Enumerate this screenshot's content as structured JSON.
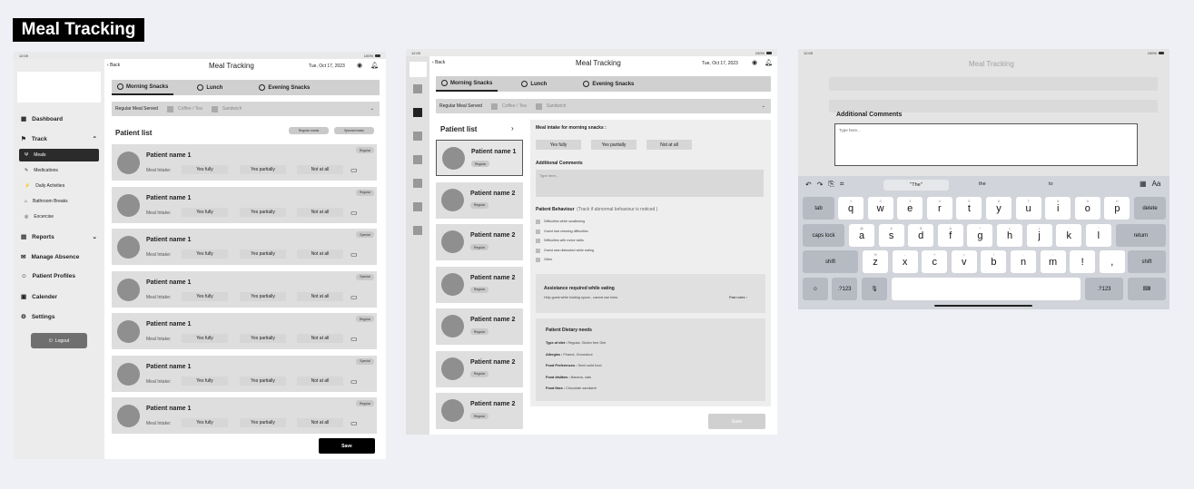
{
  "badge": "Meal Tracking",
  "status": {
    "time": "12:09",
    "date": "Tue, Oct 17",
    "battery": "100%"
  },
  "header": {
    "back": "Back",
    "title": "Meal Tracking",
    "date": "Tue, Oct 17, 2023"
  },
  "tabs": [
    "Morning Snacks",
    "Lunch",
    "Evening Snacks"
  ],
  "served": {
    "label": "Regular Meal Served",
    "opt1": "Coffee / Tea",
    "opt2": "Sandwich"
  },
  "sidebar": {
    "dashboard": "Dashboard",
    "track": "Track",
    "sub": [
      "Meals",
      "Medications",
      "Daily Activities",
      "Bathroom Breaks",
      "Excercise"
    ],
    "reports": "Reports",
    "absence": "Manage Absence",
    "profiles": "Patient Profiles",
    "calendar": "Calender",
    "settings": "Settings",
    "logout": "Logout"
  },
  "list": {
    "title": "Patient list",
    "legend1": "Regular meals",
    "legend2": "Special meals",
    "intake": "Meal Intake:",
    "yes_fully": "Yes fully",
    "yes_partially": "Yes partially",
    "not_at_all": "Not at all",
    "save": "Save",
    "patients": [
      {
        "name": "Patient name 1",
        "tag": "Regular"
      },
      {
        "name": "Patient name 1",
        "tag": "Regular"
      },
      {
        "name": "Patient name 1",
        "tag": "Special"
      },
      {
        "name": "Patient name 1",
        "tag": "Special"
      },
      {
        "name": "Patient name 1",
        "tag": "Regular"
      },
      {
        "name": "Patient name 1",
        "tag": "Special"
      },
      {
        "name": "Patient name 1",
        "tag": "Regular"
      }
    ]
  },
  "detail": {
    "list_title": "Patient list",
    "patients": [
      {
        "name": "Patient name 1",
        "tag": "Regular"
      },
      {
        "name": "Patient name 2",
        "tag": "Regular"
      },
      {
        "name": "Patient name 2",
        "tag": "Regular"
      },
      {
        "name": "Patient name 2",
        "tag": "Regular"
      },
      {
        "name": "Patient name 2",
        "tag": "Regular"
      },
      {
        "name": "Patient name 2",
        "tag": "Regular"
      },
      {
        "name": "Patient name 2",
        "tag": "Regular"
      }
    ],
    "intake_title": "Meal intake for morning snacks :",
    "comments": "Additional Comments",
    "placeholder": "Type here...",
    "behaviour": "Patient Behaviour",
    "behaviour_hint": "(Track if abnormal behaviour is noticed )",
    "behaviours": [
      "Difficulties while swallowing",
      "Guest had chewing difficulties",
      "Difficulties with motor skills",
      "Guest was distracted while eating",
      "Other"
    ],
    "assist_title": "Assistance required while eating",
    "assist_text": "Help guest while holding spoon , cannot use forks",
    "past_notes": "Past notes",
    "diet_title": "Patient Dietary needs",
    "diet": [
      {
        "k": "Type of diet :",
        "v": "Regular, Gluten free Diet"
      },
      {
        "k": "Allergies :",
        "v": "Peanut, Groundnut"
      },
      {
        "k": "Food Preferences :",
        "v": "Semi solid food"
      },
      {
        "k": "Food dislikes :",
        "v": "Banana, oats"
      },
      {
        "k": "Food likes :",
        "v": "Chocolate sandwich"
      }
    ]
  },
  "kb": {
    "comments": "Additional Comments",
    "placeholder": "Type here...",
    "suggest": [
      "\"The\"",
      "the",
      "to"
    ],
    "row1": [
      "q",
      "w",
      "e",
      "r",
      "t",
      "y",
      "u",
      "i",
      "o",
      "p"
    ],
    "row1num": [
      "1",
      "2",
      "3",
      "4",
      "5",
      "6",
      "7",
      "8",
      "9",
      "0"
    ],
    "row2": [
      "a",
      "s",
      "d",
      "f",
      "g",
      "h",
      "j",
      "k",
      "l"
    ],
    "row2num": [
      "@",
      "#",
      "$",
      "&",
      "*",
      "(",
      ")",
      "'",
      "\""
    ],
    "row3": [
      "z",
      "x",
      "c",
      "v",
      "b",
      "n",
      "m",
      "!",
      ","
    ],
    "row3alt": [
      "%",
      "-",
      "+",
      "=",
      "/",
      ";",
      ":",
      ",",
      "."
    ],
    "tab": "tab",
    "delete": "delete",
    "caps": "caps lock",
    "return": "return",
    "shift": "shift",
    "num": ".?123"
  }
}
